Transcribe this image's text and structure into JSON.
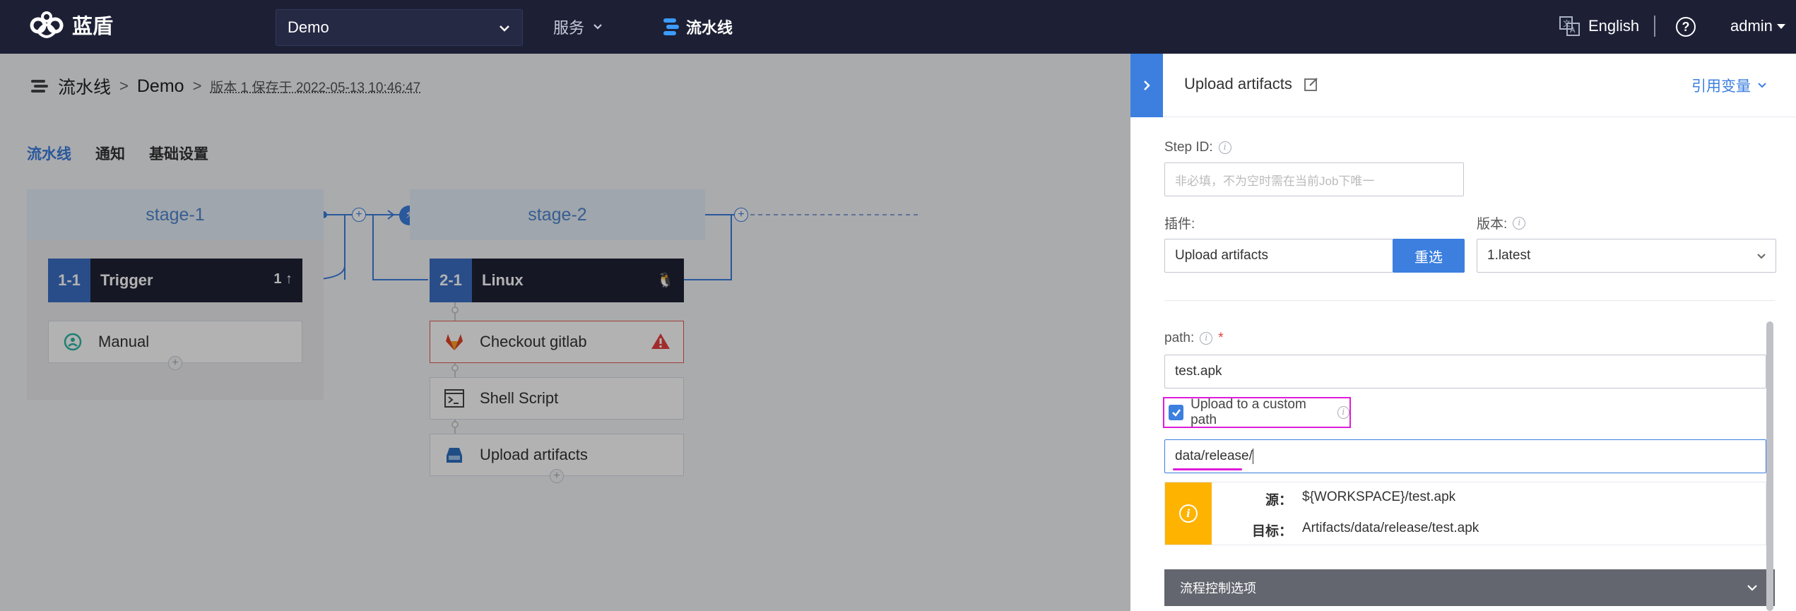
{
  "topbar": {
    "brand": "蓝盾",
    "project": "Demo",
    "nav_service": "服务",
    "nav_pipeline": "流水线",
    "language": "English",
    "user": "admin"
  },
  "breadcrumb": {
    "root": "流水线",
    "pipeline": "Demo",
    "version": "版本 1 保存于 2022-05-13 10:46:47"
  },
  "tabs": [
    "流水线",
    "通知",
    "基础设置"
  ],
  "stages": [
    {
      "name": "stage-1",
      "job": {
        "index": "1-1",
        "name": "Trigger",
        "trail": "1"
      },
      "elements": [
        {
          "name": "Manual",
          "icon": "manual-trigger-icon"
        }
      ]
    },
    {
      "name": "stage-2",
      "job": {
        "index": "2-1",
        "name": "Linux",
        "trail": ""
      },
      "elements": [
        {
          "name": "Checkout gitlab",
          "icon": "gitlab-icon",
          "error": true
        },
        {
          "name": "Shell Script",
          "icon": "terminal-icon"
        },
        {
          "name": "Upload artifacts",
          "icon": "upload-icon"
        }
      ]
    }
  ],
  "panel": {
    "title": "Upload artifacts",
    "ref_var": "引用变量",
    "step_id_label": "Step ID:",
    "step_id_placeholder": "非必填，不为空时需在当前Job下唯一",
    "plugin_label": "插件:",
    "plugin_value": "Upload artifacts",
    "reselect": "重选",
    "version_label": "版本:",
    "version_value": "1.latest",
    "path_label": "path:",
    "path_value": "test.apk",
    "custom_path_label": "Upload to a custom path",
    "custom_path_checked": true,
    "custom_path_value": "data/release/",
    "info_source_label": "源：",
    "info_source_value": "${WORKSPACE}/test.apk",
    "info_target_label": "目标：",
    "info_target_value": "Artifacts/data/release/test.apk",
    "flow_control": "流程控制选项"
  },
  "colors": {
    "topbar_bg": "#1d2035",
    "accent": "#3c7fdf",
    "highlight": "#e01bd8",
    "warning": "#fdb300",
    "error": "#e35a52"
  }
}
